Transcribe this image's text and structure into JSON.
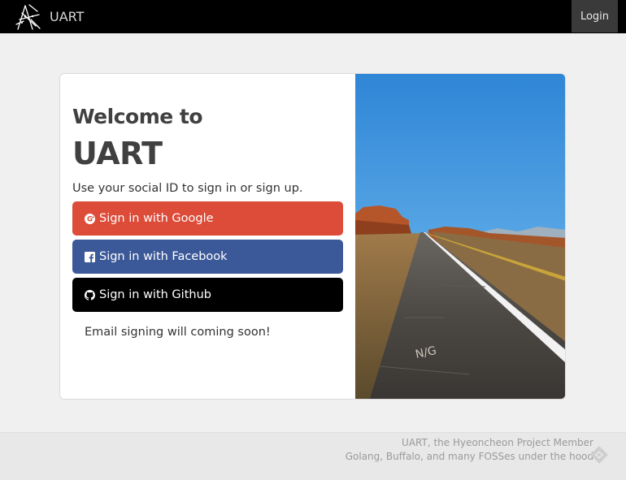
{
  "navbar": {
    "brand_logo_icon": "scribble-logo-icon",
    "brand_text": "UART",
    "login_label": "Login"
  },
  "card": {
    "welcome": "Welcome to",
    "app_title": "UART",
    "subtitle": "Use your social ID to sign in or sign up.",
    "buttons": [
      {
        "label": "Sign in with Google",
        "icon": "google-plus-icon",
        "color": "#dd4b39"
      },
      {
        "label": "Sign in with Facebook",
        "icon": "facebook-icon",
        "color": "#3b5998"
      },
      {
        "label": "Sign in with Github",
        "icon": "github-icon",
        "color": "#000000"
      }
    ],
    "email_note": "Email signing will coming soon!",
    "photo": {
      "road_marking": "N/G"
    }
  },
  "footer": {
    "line1": "UART, the Hyeoncheon Project Member",
    "line2": "Golang, Buffalo, and many FOSSes under the hood",
    "icon": "buffalo-logo-icon"
  },
  "colors": {
    "navbar_bg": "#000000",
    "page_bg": "#f0f0f0",
    "footer_bg": "#e8e8e8"
  }
}
